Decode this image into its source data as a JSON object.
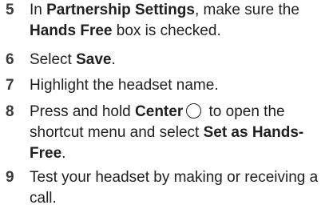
{
  "steps": [
    {
      "number": "5",
      "parts": [
        "In ",
        "Partnership Settings",
        ", make sure the ",
        "Hands Free",
        " box is checked."
      ]
    },
    {
      "number": "6",
      "parts": [
        "Select ",
        "Save",
        "."
      ]
    },
    {
      "number": "7",
      "parts": [
        "Highlight the headset name."
      ]
    },
    {
      "number": "8",
      "parts": [
        "Press and hold ",
        "Center",
        " to open the shortcut menu and select ",
        "Set as Hands-Free",
        "."
      ],
      "icon": "center-button-icon"
    },
    {
      "number": "9",
      "parts": [
        "Test your headset by making or receiving a call."
      ]
    }
  ]
}
